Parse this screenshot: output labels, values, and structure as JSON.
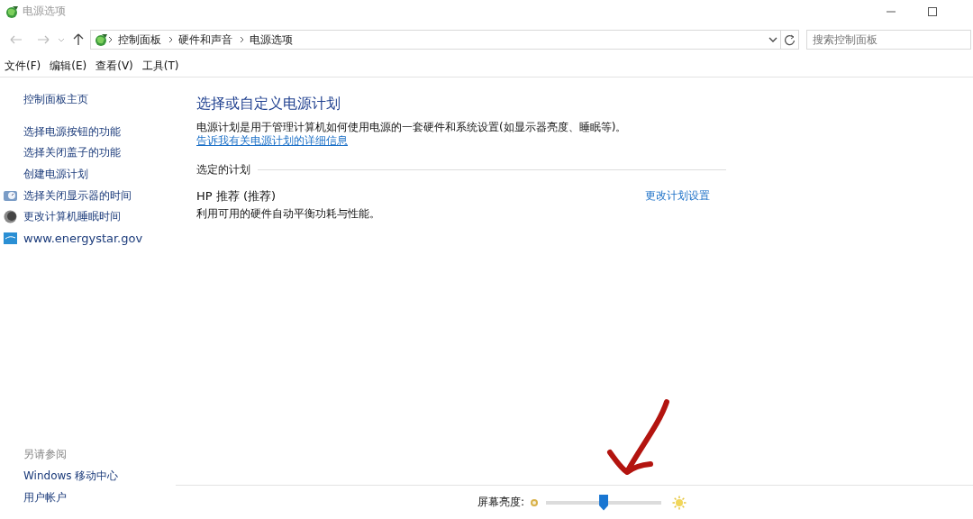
{
  "window": {
    "title": "电源选项"
  },
  "address_bar": {
    "path": [
      "控制面板",
      "硬件和声音",
      "电源选项"
    ]
  },
  "search": {
    "placeholder": "搜索控制面板"
  },
  "menu": [
    "文件(F)",
    "编辑(E)",
    "查看(V)",
    "工具(T)"
  ],
  "sidebar": {
    "home": "控制面板主页",
    "links": [
      {
        "label": "选择电源按钮的功能",
        "kind": "text"
      },
      {
        "label": "选择关闭盖子的功能",
        "kind": "text"
      },
      {
        "label": "创建电源计划",
        "kind": "text"
      },
      {
        "label": "选择关闭显示器的时间",
        "kind": "display"
      },
      {
        "label": "更改计算机睡眠时间",
        "kind": "sleep"
      },
      {
        "label": "www.energystar.gov",
        "kind": "web"
      }
    ],
    "see_also": {
      "heading": "另请参阅",
      "links": [
        "Windows 移动中心",
        "用户帐户"
      ]
    }
  },
  "main": {
    "heading": "选择或自定义电源计划",
    "description": "电源计划是用于管理计算机如何使用电源的一套硬件和系统设置(如显示器亮度、睡眠等)。",
    "more_link": "告诉我有关电源计划的详细信息",
    "section": "选定的计划",
    "plan": {
      "name": "HP 推荐 (推荐)",
      "description": "利用可用的硬件自动平衡功耗与性能。",
      "action": "更改计划设置"
    }
  },
  "brightness": {
    "label": "屏幕亮度:",
    "level": 0.5
  },
  "annotation": {
    "kind": "arrow"
  }
}
